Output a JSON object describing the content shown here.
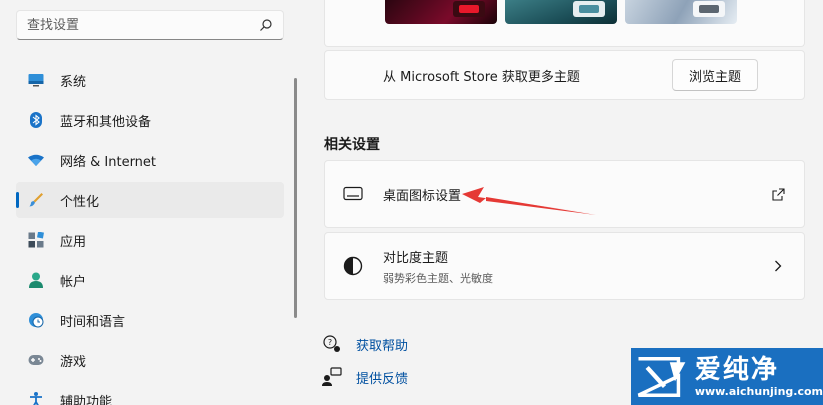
{
  "search": {
    "placeholder": "查找设置"
  },
  "nav": {
    "items": [
      {
        "label": "系统",
        "icon": "system-icon"
      },
      {
        "label": "蓝牙和其他设备",
        "icon": "bluetooth-icon"
      },
      {
        "label": "网络 & Internet",
        "icon": "wifi-icon"
      },
      {
        "label": "个性化",
        "icon": "brush-icon",
        "active": true
      },
      {
        "label": "应用",
        "icon": "apps-icon"
      },
      {
        "label": "帐户",
        "icon": "person-icon"
      },
      {
        "label": "时间和语言",
        "icon": "globe-clock-icon"
      },
      {
        "label": "游戏",
        "icon": "gamepad-icon"
      },
      {
        "label": "辅助功能",
        "icon": "accessibility-icon"
      }
    ]
  },
  "themes": {
    "store_text": "从 Microsoft Store 获取更多主题",
    "browse_button": "浏览主题"
  },
  "related": {
    "title": "相关设置",
    "desktop_icons": {
      "title": "桌面图标设置"
    },
    "contrast": {
      "title": "对比度主题",
      "subtitle": "弱势彩色主题、光敏度"
    }
  },
  "help": {
    "get_help": "获取帮助",
    "feedback": "提供反馈"
  },
  "watermark": {
    "cn": "爱纯净",
    "en": "www.aichunjing.com"
  },
  "colors": {
    "accent": "#0067c0",
    "annotation_arrow": "#e53935",
    "watermark_bg": "#1a6fc0"
  }
}
